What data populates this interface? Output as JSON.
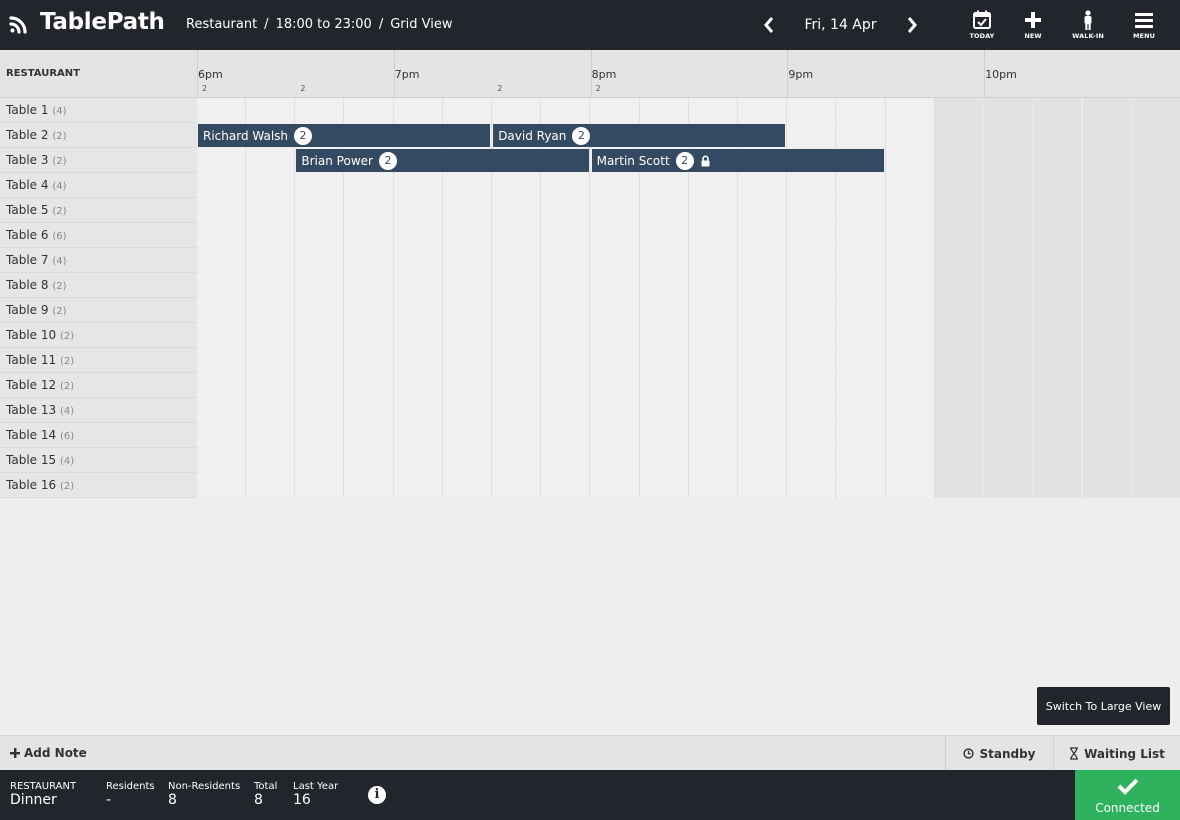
{
  "app": {
    "name": "TablePath"
  },
  "breadcrumb": [
    "Restaurant",
    "/",
    "18:00 to 23:00",
    "/",
    "Grid View"
  ],
  "date_nav": {
    "date": "Fri, 14 Apr",
    "prev_icon": "chevron-left-icon",
    "next_icon": "chevron-right-icon"
  },
  "toolbar": {
    "today": "TODAY",
    "new": "NEW",
    "walkin": "WALK-IN",
    "menu": "MENU"
  },
  "grid": {
    "section_label": "RESTAURANT",
    "hours": [
      "6pm",
      "7pm",
      "8pm",
      "9pm",
      "10pm"
    ],
    "slot_minutes": 15,
    "start": "18:00",
    "open_until": "21:45",
    "cover_counts": [
      {
        "time": "18:00",
        "count": "2"
      },
      {
        "time": "18:30",
        "count": "2"
      },
      {
        "time": "19:30",
        "count": "2"
      },
      {
        "time": "20:00",
        "count": "2"
      }
    ],
    "tables": [
      {
        "name": "Table 1",
        "capacity": "(4)"
      },
      {
        "name": "Table 2",
        "capacity": "(2)"
      },
      {
        "name": "Table 3",
        "capacity": "(2)"
      },
      {
        "name": "Table 4",
        "capacity": "(4)"
      },
      {
        "name": "Table 5",
        "capacity": "(2)"
      },
      {
        "name": "Table 6",
        "capacity": "(6)"
      },
      {
        "name": "Table 7",
        "capacity": "(4)"
      },
      {
        "name": "Table 8",
        "capacity": "(2)"
      },
      {
        "name": "Table 9",
        "capacity": "(2)"
      },
      {
        "name": "Table 10",
        "capacity": "(2)"
      },
      {
        "name": "Table 11",
        "capacity": "(2)"
      },
      {
        "name": "Table 12",
        "capacity": "(2)"
      },
      {
        "name": "Table 13",
        "capacity": "(4)"
      },
      {
        "name": "Table 14",
        "capacity": "(6)"
      },
      {
        "name": "Table 15",
        "capacity": "(4)"
      },
      {
        "name": "Table 16",
        "capacity": "(2)"
      }
    ],
    "bookings": [
      {
        "table": 1,
        "name": "Richard Walsh",
        "covers": "2",
        "start": "18:00",
        "end": "19:30",
        "locked": false
      },
      {
        "table": 1,
        "name": "David Ryan",
        "covers": "2",
        "start": "19:30",
        "end": "21:00",
        "locked": false
      },
      {
        "table": 2,
        "name": "Brian Power",
        "covers": "2",
        "start": "18:30",
        "end": "20:00",
        "locked": false
      },
      {
        "table": 2,
        "name": "Martin Scott",
        "covers": "2",
        "start": "20:00",
        "end": "21:30",
        "locked": true
      }
    ]
  },
  "switch_view": "Switch To Large View",
  "actions": {
    "add_note": "Add Note",
    "standby": "Standby",
    "waiting_list": "Waiting List"
  },
  "footer": {
    "section": "RESTAURANT",
    "service": "Dinner",
    "residents_label": "Residents",
    "residents": "-",
    "non_residents_label": "Non-Residents",
    "non_residents": "8",
    "total_label": "Total",
    "total": "8",
    "last_year_label": "Last Year",
    "last_year": "16",
    "status": "Connected",
    "status_color": "#2fb25d"
  }
}
